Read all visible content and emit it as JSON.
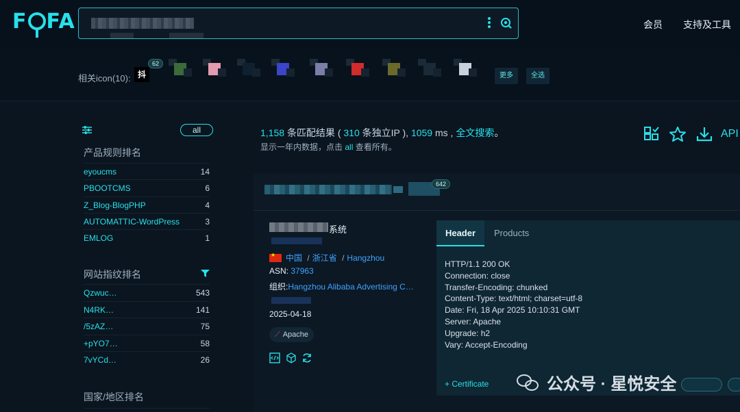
{
  "header": {
    "logo": "FOFA",
    "search_value": "",
    "nav": [
      "会员",
      "支持及工具"
    ]
  },
  "icons_bar": {
    "label": "相关icon(10):",
    "first_icon_text": "抖",
    "first_icon_count": "62",
    "more_label": "更多",
    "select_all_label": "全选"
  },
  "sidebar": {
    "all_label": "all",
    "product_title": "产品规则排名",
    "products": [
      {
        "name": "eyoucms",
        "count": "14"
      },
      {
        "name": "PBOOTCMS",
        "count": "6"
      },
      {
        "name": "Z_Blog-BlogPHP",
        "count": "4"
      },
      {
        "name": "AUTOMATTIC-WordPress",
        "count": "3"
      },
      {
        "name": "EMLOG",
        "count": "1"
      }
    ],
    "fingerprint_title": "网站指纹排名",
    "fingerprints": [
      {
        "name": "Qzwuc…",
        "count": "543"
      },
      {
        "name": "N4RK…",
        "count": "141"
      },
      {
        "name": "/5zAZ…",
        "count": "75"
      },
      {
        "name": "+pYO7…",
        "count": "58"
      },
      {
        "name": "7vYCd…",
        "count": "26"
      }
    ],
    "country_title": "国家/地区排名"
  },
  "stats": {
    "count": "1,158",
    "matches_label": "条匹配结果 (",
    "ip_count": "310",
    "ip_label": "条独立IP ),",
    "time": "1059",
    "time_unit": "ms ,",
    "fulltext_label": "全文搜索",
    "period": "。",
    "hint_prefix": "显示一年内数据，点击",
    "hint_all": "all",
    "hint_suffix": "查看所有。",
    "api_label": "API"
  },
  "result": {
    "head_badge": "642",
    "title_suffix": "系统",
    "country": "中国",
    "sep": "/",
    "province": "浙江省",
    "city": "Hangzhou",
    "asn_label": "ASN:",
    "asn": "37963",
    "org_label": "组织:",
    "org": "Hangzhou Alibaba Advertising C…",
    "date": "2025-04-18",
    "tag": "Apache"
  },
  "panel": {
    "tabs": [
      "Header",
      "Products"
    ],
    "lines": [
      "HTTP/1.1 200 OK",
      "Connection: close",
      "Transfer-Encoding: chunked",
      "Content-Type: text/html; charset=utf-8",
      "Date: Fri, 18 Apr 2025 10:10:31 GMT",
      "Server: Apache",
      "Upgrade: h2",
      "Vary: Accept-Encoding"
    ],
    "certificate_label": "+ Certificate"
  },
  "watermark": "公众号 · 星悦安全",
  "colors": {
    "accent": "#29e0e8",
    "link": "#3ea3ff",
    "background": "#0a1520"
  }
}
